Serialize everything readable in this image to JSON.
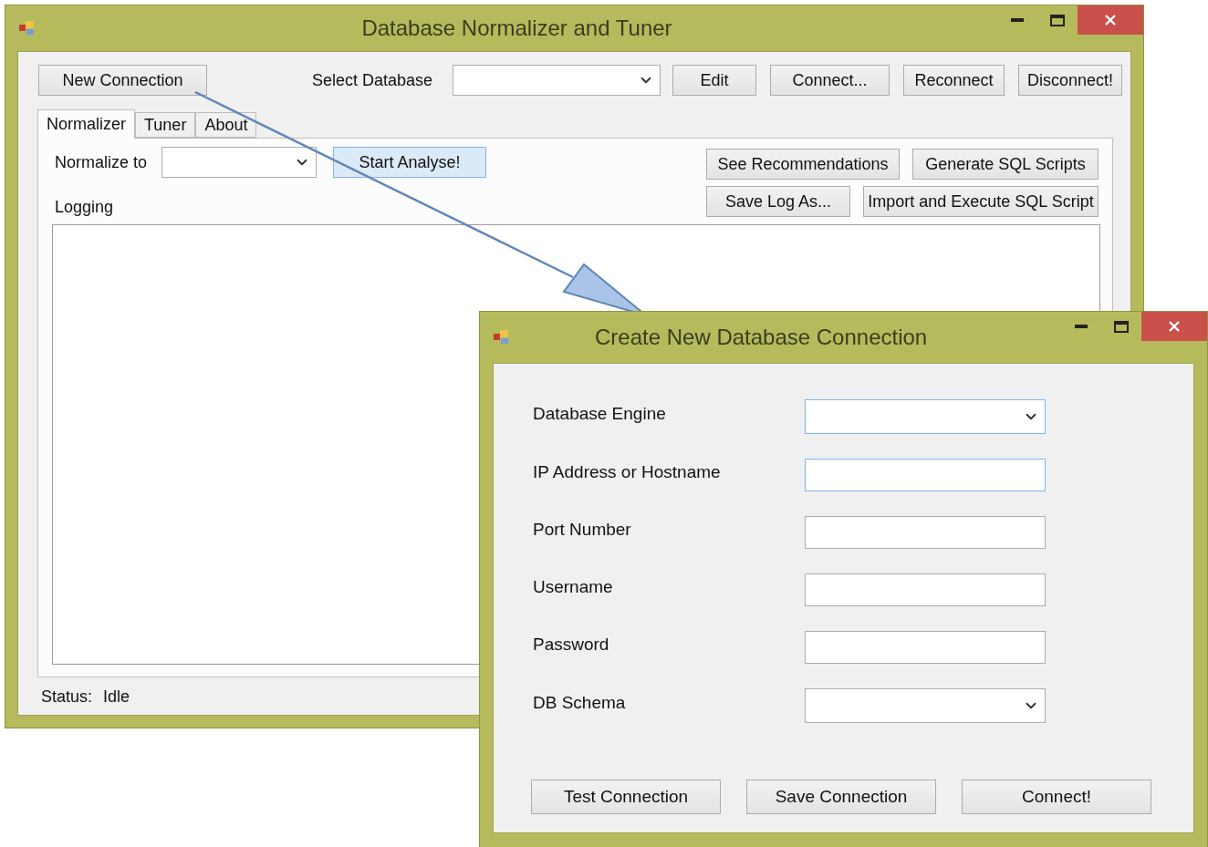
{
  "main_window": {
    "title": "Database Normalizer and Tuner",
    "new_connection": "New Connection",
    "select_label": "Select Database",
    "top_buttons": [
      "Edit",
      "Connect...",
      "Reconnect",
      "Disconnect!"
    ],
    "tabs": [
      {
        "label": "Normalizer",
        "selected": true
      },
      {
        "label": "Tuner",
        "selected": false
      },
      {
        "label": "About",
        "selected": false
      }
    ],
    "normalize_label": "Normalize to",
    "start_button": {
      "label": "Start Analyse!",
      "focused": true
    },
    "action_buttons": [
      "See Recommendations",
      "Generate SQL Scripts",
      "Save Log As...",
      "Import and Execute SQL Script"
    ],
    "logging_label": "Logging",
    "status": {
      "label": "Status:",
      "value": "Idle"
    }
  },
  "dialog": {
    "title": "Create New Database Connection",
    "fields": [
      {
        "label": "Database Engine",
        "kind": "combo",
        "focused": true
      },
      {
        "label": "IP Address or Hostname",
        "kind": "text",
        "focused": true
      },
      {
        "label": "Port Number",
        "kind": "text",
        "focused": false
      },
      {
        "label": "Username",
        "kind": "text",
        "focused": false
      },
      {
        "label": "Password",
        "kind": "text",
        "focused": false
      },
      {
        "label": "DB Schema",
        "kind": "combo",
        "focused": false
      }
    ],
    "buttons": [
      "Test Connection",
      "Save Connection",
      "Connect!"
    ]
  }
}
